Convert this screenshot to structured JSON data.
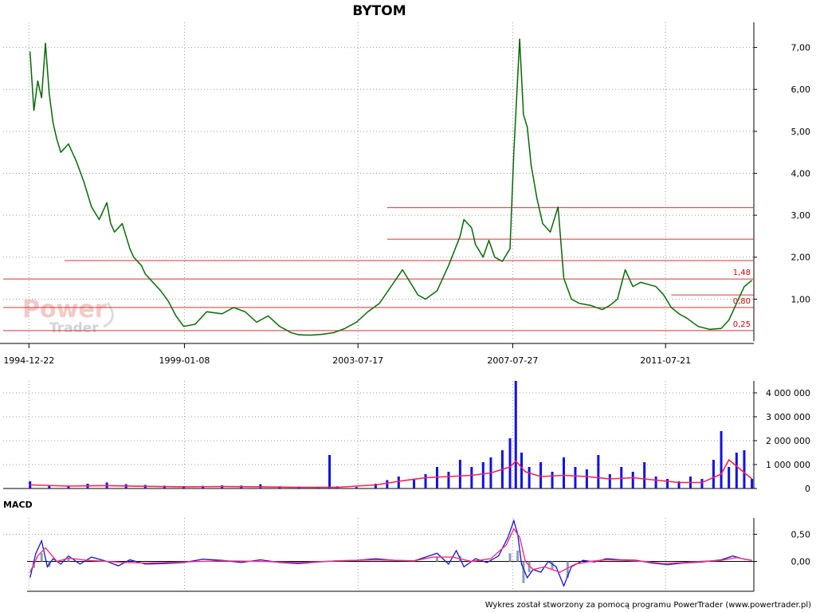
{
  "chart_data": [
    {
      "type": "line",
      "title": "BYTOM",
      "y_tick_labels": [
        "7,00",
        "6,00",
        "5,00",
        "4,00",
        "3,00",
        "2,00",
        "1,00"
      ],
      "y_ticks": [
        7,
        6,
        5,
        4,
        3,
        2,
        1
      ],
      "ylim": [
        0,
        7.6
      ],
      "x_tick_labels": [
        "1994-12-22",
        "1999-01-08",
        "2003-07-17",
        "2007-07-27",
        "2011-07-21"
      ],
      "x_ticks": [
        1994.97,
        1999.02,
        2003.54,
        2007.57,
        2011.55
      ],
      "xlim": [
        1994.3,
        2013.85
      ],
      "grid": true,
      "colors": {
        "price": "#1a8a1a",
        "level": "#e03030"
      },
      "series": [
        {
          "x": [
            1995.0,
            1995.1,
            1995.2,
            1995.3,
            1995.4,
            1995.5,
            1995.6,
            1995.7,
            1995.8,
            1996.0,
            1996.2,
            1996.4,
            1996.6,
            1996.8,
            1997.0,
            1997.1,
            1997.2,
            1997.4,
            1997.5,
            1997.6,
            1997.7,
            1997.9,
            1998.0,
            1998.2,
            1998.4,
            1998.6,
            1998.8,
            1999.0,
            1999.3,
            1999.6,
            2000.0,
            2000.3,
            2000.6,
            2000.9,
            2001.2,
            2001.5,
            2001.8,
            2002.0,
            2002.3,
            2002.6,
            2002.9,
            2003.2,
            2003.5,
            2003.8,
            2004.1,
            2004.4,
            2004.7,
            2004.9,
            2005.1,
            2005.3,
            2005.6,
            2005.9,
            2006.2,
            2006.3,
            2006.5,
            2006.6,
            2006.8,
            2006.95,
            2007.1,
            2007.3,
            2007.5,
            2007.6,
            2007.75,
            2007.85,
            2007.95,
            2008.05,
            2008.2,
            2008.35,
            2008.55,
            2008.75,
            2008.9,
            2009.1,
            2009.3,
            2009.6,
            2009.9,
            2010.1,
            2010.3,
            2010.5,
            2010.7,
            2010.9,
            2011.1,
            2011.3,
            2011.5,
            2011.7,
            2011.9,
            2012.1,
            2012.4,
            2012.7,
            2013.0,
            2013.2,
            2013.4,
            2013.6,
            2013.8
          ],
          "y": [
            6.9,
            5.5,
            6.2,
            5.8,
            7.1,
            5.9,
            5.2,
            4.8,
            4.5,
            4.7,
            4.3,
            3.8,
            3.2,
            2.9,
            3.3,
            2.8,
            2.6,
            2.8,
            2.5,
            2.2,
            2.0,
            1.8,
            1.6,
            1.4,
            1.2,
            0.95,
            0.6,
            0.35,
            0.4,
            0.7,
            0.65,
            0.8,
            0.7,
            0.45,
            0.6,
            0.35,
            0.2,
            0.15,
            0.14,
            0.16,
            0.2,
            0.3,
            0.45,
            0.7,
            0.9,
            1.3,
            1.7,
            1.4,
            1.1,
            1.0,
            1.2,
            1.8,
            2.5,
            2.9,
            2.7,
            2.3,
            2.0,
            2.4,
            2.0,
            1.9,
            2.2,
            4.5,
            7.2,
            5.4,
            5.1,
            4.2,
            3.4,
            2.8,
            2.6,
            3.2,
            1.5,
            1.0,
            0.9,
            0.85,
            0.75,
            0.85,
            1.0,
            1.7,
            1.3,
            1.4,
            1.35,
            1.3,
            1.1,
            0.8,
            0.65,
            0.55,
            0.35,
            0.28,
            0.3,
            0.5,
            0.9,
            1.3,
            1.45
          ]
        }
      ],
      "h_levels": [
        {
          "value": 3.18,
          "x_from": 2004.3
        },
        {
          "value": 2.43,
          "x_from": 2004.3
        },
        {
          "value": 1.92,
          "x_from": 1995.9
        },
        {
          "value": 1.48,
          "x_from": 1994.3,
          "label": "1,48"
        },
        {
          "value": 1.1,
          "x_from": 2011.7
        },
        {
          "value": 0.8,
          "x_from": 1994.3,
          "label": "0,80"
        },
        {
          "value": 0.25,
          "x_from": 1994.3,
          "label": "0,25"
        }
      ]
    },
    {
      "type": "bar",
      "y_tick_labels": [
        "4 000 000",
        "3 000 000",
        "2 000 000",
        "1 000 000",
        "0"
      ],
      "y_ticks": [
        4000000,
        3000000,
        2000000,
        1000000,
        0
      ],
      "ylim": [
        0,
        4500000
      ],
      "xlim": [
        1994.3,
        2013.85
      ],
      "colors": {
        "volume": "#1010e8",
        "average": "#ff2050"
      },
      "series": [
        {
          "x": [
            1995.0,
            1995.5,
            1996.0,
            1996.5,
            1997.0,
            1997.5,
            1998.0,
            1998.5,
            1999.0,
            1999.5,
            2000.0,
            2000.5,
            2001.0,
            2001.5,
            2002.0,
            2002.5,
            2002.8,
            2003.0,
            2003.5,
            2004.0,
            2004.3,
            2004.6,
            2005.0,
            2005.3,
            2005.6,
            2005.9,
            2006.2,
            2006.5,
            2006.8,
            2007.0,
            2007.3,
            2007.5,
            2007.65,
            2007.8,
            2008.0,
            2008.3,
            2008.6,
            2008.9,
            2009.2,
            2009.5,
            2009.8,
            2010.1,
            2010.4,
            2010.7,
            2011.0,
            2011.3,
            2011.6,
            2011.9,
            2012.2,
            2012.5,
            2012.8,
            2013.0,
            2013.2,
            2013.4,
            2013.6,
            2013.8
          ],
          "values": [
            300000,
            150000,
            120000,
            200000,
            250000,
            180000,
            150000,
            120000,
            100000,
            110000,
            130000,
            120000,
            180000,
            90000,
            80000,
            70000,
            1400000,
            90000,
            60000,
            200000,
            350000,
            500000,
            400000,
            600000,
            900000,
            700000,
            1200000,
            900000,
            1100000,
            1300000,
            1600000,
            2100000,
            4500000,
            1500000,
            900000,
            1100000,
            700000,
            1300000,
            900000,
            800000,
            1400000,
            600000,
            900000,
            700000,
            1100000,
            500000,
            400000,
            300000,
            500000,
            400000,
            1200000,
            2400000,
            900000,
            1500000,
            1600000,
            400000
          ]
        },
        {
          "name_hidden": "",
          "x": [
            1995.0,
            1996.0,
            1997.0,
            1998.0,
            1999.0,
            2000.0,
            2001.0,
            2002.0,
            2003.0,
            2004.0,
            2004.6,
            2005.3,
            2005.9,
            2006.5,
            2007.0,
            2007.5,
            2007.65,
            2007.9,
            2008.3,
            2008.9,
            2009.5,
            2010.1,
            2010.7,
            2011.3,
            2011.9,
            2012.5,
            2013.0,
            2013.2,
            2013.5,
            2013.8
          ],
          "values": [
            150000,
            100000,
            120000,
            90000,
            70000,
            80000,
            70000,
            50000,
            50000,
            150000,
            300000,
            450000,
            500000,
            550000,
            650000,
            900000,
            1150000,
            700000,
            500000,
            550000,
            500000,
            400000,
            450000,
            350000,
            250000,
            250000,
            600000,
            1200000,
            800000,
            400000
          ]
        }
      ]
    },
    {
      "type": "line",
      "panel_title": "MACD",
      "y_tick_labels": [
        "0,50",
        "0,00"
      ],
      "y_ticks": [
        0.5,
        0
      ],
      "ylim": [
        -0.55,
        0.8
      ],
      "xlim": [
        1994.3,
        2013.85
      ],
      "colors": {
        "macd": "#1515d0",
        "signal": "#ff2d7a",
        "histogram": "#8aa0b8"
      },
      "series": [
        {
          "x": [
            1995.0,
            1995.15,
            1995.3,
            1995.45,
            1995.6,
            1995.8,
            1996.0,
            1996.3,
            1996.6,
            1997.0,
            1997.3,
            1997.6,
            1998.0,
            1998.5,
            1999.0,
            1999.5,
            2000.0,
            2000.5,
            2001.0,
            2001.5,
            2002.0,
            2002.5,
            2003.0,
            2003.5,
            2004.0,
            2004.5,
            2005.0,
            2005.3,
            2005.6,
            2005.9,
            2006.1,
            2006.3,
            2006.6,
            2006.9,
            2007.2,
            2007.45,
            2007.6,
            2007.7,
            2007.8,
            2007.95,
            2008.1,
            2008.3,
            2008.5,
            2008.7,
            2008.9,
            2009.1,
            2009.4,
            2009.7,
            2010.0,
            2010.4,
            2010.8,
            2011.2,
            2011.6,
            2012.0,
            2012.5,
            2013.0,
            2013.3,
            2013.6,
            2013.8
          ],
          "values": [
            -0.3,
            0.15,
            0.38,
            -0.1,
            0.05,
            -0.05,
            0.1,
            -0.05,
            0.08,
            0.0,
            -0.08,
            0.03,
            -0.05,
            -0.04,
            -0.02,
            0.04,
            0.02,
            -0.02,
            0.03,
            -0.02,
            -0.04,
            -0.01,
            0.01,
            0.02,
            0.05,
            0.02,
            0.01,
            0.08,
            0.15,
            -0.05,
            0.2,
            -0.1,
            0.05,
            -0.02,
            0.1,
            0.45,
            0.75,
            0.5,
            -0.05,
            -0.3,
            -0.15,
            -0.2,
            0.0,
            -0.1,
            -0.45,
            -0.1,
            0.02,
            -0.01,
            0.05,
            0.03,
            0.02,
            -0.03,
            -0.06,
            -0.03,
            -0.01,
            0.03,
            0.1,
            0.04,
            0.02
          ]
        },
        {
          "x": [
            1995.0,
            1995.2,
            1995.4,
            1995.7,
            1996.0,
            1996.5,
            1997.0,
            1997.5,
            1998.0,
            1999.0,
            2000.0,
            2001.0,
            2002.0,
            2003.0,
            2004.0,
            2005.0,
            2005.5,
            2006.0,
            2006.5,
            2007.0,
            2007.4,
            2007.6,
            2007.75,
            2007.9,
            2008.1,
            2008.4,
            2008.8,
            2009.2,
            2009.6,
            2010.0,
            2010.5,
            2011.0,
            2011.5,
            2012.0,
            2012.5,
            2013.0,
            2013.4,
            2013.8
          ],
          "values": [
            -0.2,
            0.1,
            0.25,
            0.0,
            0.06,
            0.02,
            0.0,
            -0.02,
            -0.03,
            -0.01,
            0.01,
            0.0,
            -0.02,
            0.01,
            0.03,
            0.01,
            0.08,
            0.08,
            0.0,
            0.05,
            0.3,
            0.6,
            0.45,
            0.0,
            -0.15,
            -0.1,
            -0.2,
            -0.05,
            0.0,
            0.03,
            0.02,
            0.0,
            -0.04,
            -0.02,
            0.0,
            0.02,
            0.07,
            0.02
          ]
        }
      ],
      "histogram": {
        "x": [
          1995.1,
          1995.3,
          1995.5,
          1996.0,
          2005.6,
          2006.2,
          2007.5,
          2007.7,
          2007.85,
          2008.0,
          2008.6,
          2009.0
        ],
        "values": [
          -0.12,
          0.15,
          -0.1,
          0.05,
          0.08,
          0.1,
          0.15,
          0.2,
          -0.4,
          -0.2,
          -0.15,
          -0.3
        ]
      }
    }
  ],
  "footer": "Wykres został stworzony za pomocą programu PowerTrader (www.powertrader.pl)",
  "logo": {
    "line1": "Power",
    "line2": "Trader"
  }
}
